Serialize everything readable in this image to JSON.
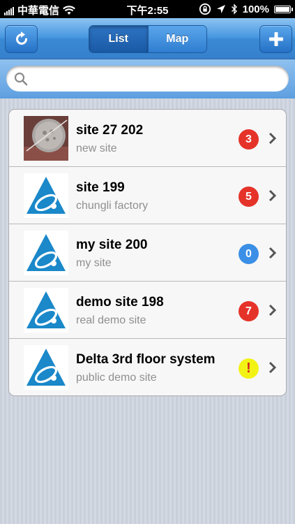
{
  "status": {
    "carrier": "中華電信",
    "time": "下午2:55",
    "battery": "100%"
  },
  "nav": {
    "refresh_icon": "refresh-icon",
    "segments": [
      "List",
      "Map"
    ],
    "selected_segment": "List",
    "add_icon": "plus-icon"
  },
  "search": {
    "placeholder": "",
    "value": ""
  },
  "sites": [
    {
      "title": "site 27 202",
      "subtitle": "new site",
      "badge": "3",
      "badge_color": "#e5332a",
      "thumb": "photo"
    },
    {
      "title": "site 199",
      "subtitle": "chungli factory",
      "badge": "5",
      "badge_color": "#e5332a",
      "thumb": "delta-logo"
    },
    {
      "title": "my site 200",
      "subtitle": "my site",
      "badge": "0",
      "badge_color": "#3b8fe6",
      "thumb": "delta-logo"
    },
    {
      "title": "demo site 198",
      "subtitle": "real demo site",
      "badge": "7",
      "badge_color": "#e5332a",
      "thumb": "delta-logo"
    },
    {
      "title": "Delta 3rd floor system",
      "subtitle": "public demo site",
      "badge": "!",
      "badge_color": "#f2f215",
      "thumb": "delta-logo"
    }
  ]
}
